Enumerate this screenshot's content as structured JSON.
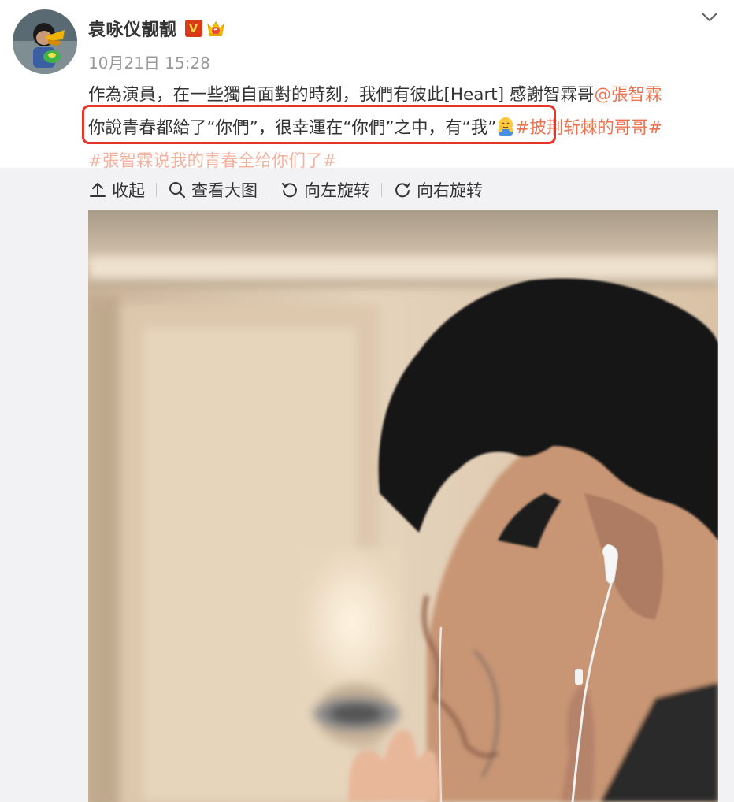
{
  "author": {
    "name": "袁咏仪靓靓",
    "verified_badge": "V",
    "timestamp": "10月21日 15:28"
  },
  "post": {
    "line1_text": "作為演員，在一些獨自面對的時刻，我們有彼此[Heart] 感謝智霖哥",
    "mention": "@張智霖",
    "line2_text": "你說青春都給了“你們”，很幸運在“你們”之中，有“我”",
    "hashtag1": "#披荆斩棘的哥哥#",
    "hashtag2": "#張智霖说我的青春全给你们了#"
  },
  "toolbar": {
    "collapse": "收起",
    "view_large": "查看大图",
    "rotate_left": "向左旋转",
    "rotate_right": "向右旋转"
  },
  "colors": {
    "link": "#eb7350",
    "highlight_border": "#e8332b",
    "media_bg": "#f2f2f5",
    "secondary_text": "#999999"
  },
  "icons": [
    "avatar",
    "verified-icon",
    "crown-icon",
    "chevron-down-icon",
    "hug-emoji-icon",
    "collapse-icon",
    "search-icon",
    "rotate-left-icon",
    "rotate-right-icon"
  ]
}
